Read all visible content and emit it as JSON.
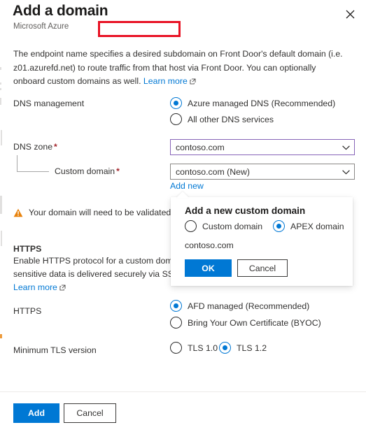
{
  "header": {
    "title": "Add a domain",
    "subtitle": "Microsoft Azure",
    "close_icon": "close-icon"
  },
  "description": {
    "text_before_link": "The endpoint name specifies a desired subdomain on Front Door's default domain (i.e. z01.azurefd.net) to route traffic from that host via Front Door. You can optionally onboard custom domains as well. ",
    "link_label": "Learn more"
  },
  "dns_management": {
    "label": "DNS management",
    "options": [
      {
        "label": "Azure managed DNS (Recommended)",
        "selected": true
      },
      {
        "label": "All other DNS services",
        "selected": false
      }
    ]
  },
  "dns_zone": {
    "label": "DNS zone",
    "required_marker": "*",
    "value": "contoso.com",
    "chevron_icon": "chevron-down-icon"
  },
  "custom_domain": {
    "label": "Custom domain",
    "required_marker": "*",
    "value": "contoso.com (New)",
    "chevron_icon": "chevron-down-icon",
    "add_new_label": "Add new"
  },
  "validation_warning": {
    "icon": "warning-icon",
    "text": "Your domain will need to be validated befo"
  },
  "https_section": {
    "title": "HTTPS",
    "line1": "Enable HTTPS protocol for a custom domair",
    "line2": "sensitive data is delivered securely via SSL/T",
    "link_label": "Learn more"
  },
  "https_mode": {
    "label": "HTTPS",
    "options": [
      {
        "label": "AFD managed (Recommended)",
        "selected": true
      },
      {
        "label": "Bring Your Own Certificate (BYOC)",
        "selected": false
      }
    ]
  },
  "tls": {
    "label": "Minimum TLS version",
    "options": [
      {
        "label": "TLS 1.0",
        "selected": false
      },
      {
        "label": "TLS 1.2",
        "selected": true
      }
    ]
  },
  "footer": {
    "add_label": "Add",
    "cancel_label": "Cancel"
  },
  "callout": {
    "title": "Add a new custom domain",
    "options": [
      {
        "label": "Custom domain",
        "selected": false
      },
      {
        "label": "APEX domain",
        "selected": true
      }
    ],
    "domain_value": "contoso.com",
    "ok_label": "OK",
    "cancel_label": "Cancel"
  },
  "colors": {
    "accent_blue": "#0078d4",
    "highlight_red": "#e81123",
    "warning_orange": "#e8820c",
    "required_red": "#a4262c",
    "focus_purple": "#8764b8"
  }
}
